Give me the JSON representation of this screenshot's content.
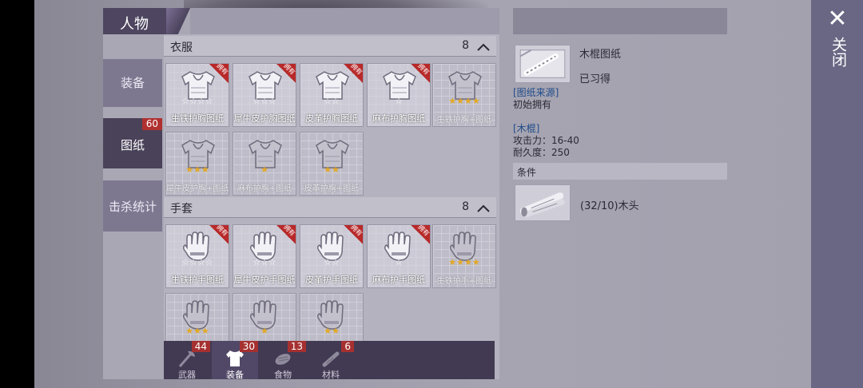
{
  "header": {
    "title": "人物",
    "close_label": "关闭"
  },
  "side_tabs": [
    {
      "label": "装备"
    },
    {
      "label": "图纸",
      "badge": "60"
    },
    {
      "label": "击杀统计"
    }
  ],
  "sections": [
    {
      "title": "衣服",
      "count": "8"
    },
    {
      "title": "手套",
      "count": "8"
    }
  ],
  "owned_tag": "拥有",
  "clothes_cards": [
    {
      "name": "生铁护胸图纸",
      "stars": "☆☆☆☆",
      "owned": true
    },
    {
      "name": "犀牛皮护胸图纸",
      "stars": "☆☆☆",
      "owned": true
    },
    {
      "name": "皮革护胸图纸",
      "stars": "☆☆",
      "owned": true
    },
    {
      "name": "麻布护胸图纸",
      "stars": "☆",
      "owned": true
    },
    {
      "name": "生铁护胸+图纸",
      "stars": "★★★★",
      "owned": false
    },
    {
      "name": "犀牛皮护胸+图纸",
      "stars": "★★★",
      "owned": false
    },
    {
      "name": "麻布护胸+图纸",
      "stars": "★",
      "owned": false
    },
    {
      "name": "皮革护胸+图纸",
      "stars": "★★",
      "owned": false
    }
  ],
  "glove_cards": [
    {
      "name": "生铁护手图纸",
      "stars": "☆☆☆☆",
      "owned": true
    },
    {
      "name": "犀牛皮护手图纸",
      "stars": "☆☆☆",
      "owned": true
    },
    {
      "name": "皮革护手图纸",
      "stars": "☆☆",
      "owned": true
    },
    {
      "name": "麻布护手图纸",
      "stars": "☆",
      "owned": true
    },
    {
      "name": "生铁护手+图纸",
      "stars": "★★★★",
      "owned": false
    },
    {
      "name": "",
      "stars": "★★★",
      "owned": false
    },
    {
      "name": "",
      "stars": "★",
      "owned": false
    },
    {
      "name": "",
      "stars": "★★",
      "owned": false
    }
  ],
  "bottom_nav": [
    {
      "label": "武器",
      "badge": "44",
      "icon": "axe-icon"
    },
    {
      "label": "装备",
      "badge": "30",
      "icon": "shirt-icon"
    },
    {
      "label": "食物",
      "badge": "13",
      "icon": "food-icon"
    },
    {
      "label": "材料",
      "badge": "6",
      "icon": "material-icon"
    }
  ],
  "detail": {
    "name": "木棍图纸",
    "status": "已习得",
    "source_title": "[图纸来源]",
    "source_value": "初始拥有",
    "item_title": "[木棍]",
    "attack": "攻击力：16-40",
    "durability": "耐久度：250",
    "condition_title": "条件",
    "requirement": "(32/10)木头"
  }
}
